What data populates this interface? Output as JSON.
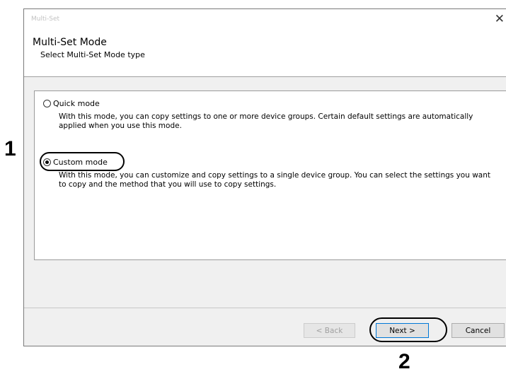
{
  "window": {
    "title": "Multi-Set",
    "close_glyph": "✕"
  },
  "header": {
    "heading": "Multi-Set Mode",
    "subheading": "Select Multi-Set Mode type"
  },
  "options": [
    {
      "label": "Quick mode",
      "selected": false,
      "description": "With this mode, you can copy settings to one or more device groups. Certain default settings are automatically applied when you use this mode."
    },
    {
      "label": "Custom mode",
      "selected": true,
      "description": "With this mode, you can customize and copy settings to a single device group. You can select the settings you want to copy and the method that you will use to copy settings."
    }
  ],
  "buttons": {
    "back": "< Back",
    "next": "Next >",
    "cancel": "Cancel"
  },
  "callouts": {
    "step1": "1",
    "step2": "2"
  }
}
